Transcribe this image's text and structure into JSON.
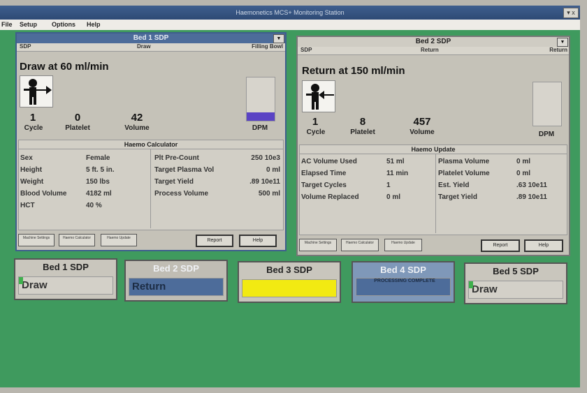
{
  "window": {
    "title": "Haemonetics MCS+ Monitoring Station",
    "control": "▾ x"
  },
  "menu": [
    "File",
    "Setup",
    "Options",
    "Help"
  ],
  "bed1": {
    "title": "Bed 1 SDP",
    "header": {
      "left": "SDP",
      "middle": "Draw",
      "right": "Filling Bowl"
    },
    "status": "Draw at 60 ml/min",
    "stats": [
      {
        "value": "1",
        "label": "Cycle"
      },
      {
        "value": "0",
        "label": "Platelet"
      },
      {
        "value": "42",
        "label": "Volume"
      }
    ],
    "dpm_label": "DPM",
    "dpm_level": 0.2,
    "calc_title": "Haemo Calculator",
    "left_rows": [
      [
        "Sex",
        "Female"
      ],
      [
        "Height",
        "5 ft. 5 in."
      ],
      [
        "Weight",
        "150 lbs"
      ],
      [
        "Blood Volume",
        "4182 ml"
      ],
      [
        "HCT",
        "40 %"
      ]
    ],
    "right_rows": [
      [
        "Plt Pre-Count",
        "250 10e3"
      ],
      [
        "Target Plasma Vol",
        "0 ml"
      ],
      [
        "Target Yield",
        ".89 10e11"
      ],
      [
        "Process Volume",
        "500 ml"
      ]
    ],
    "tabs": [
      "Machine Settings",
      "Haemo Calculator",
      "Haemo Update"
    ],
    "actions": [
      "Report",
      "Help"
    ]
  },
  "bed2": {
    "title": "Bed 2 SDP",
    "header": {
      "left": "SDP",
      "middle": "Return",
      "right": "Return"
    },
    "status": "Return at 150 ml/min",
    "stats": [
      {
        "value": "1",
        "label": "Cycle"
      },
      {
        "value": "8",
        "label": "Platelet"
      },
      {
        "value": "457",
        "label": "Volume"
      }
    ],
    "dpm_label": "DPM",
    "dpm_level": 0,
    "calc_title": "Haemo Update",
    "left_rows": [
      [
        "AC Volume Used",
        "51 ml"
      ],
      [
        "Elapsed Time",
        "11 min"
      ],
      [
        "Target Cycles",
        "1"
      ],
      [
        "Volume Replaced",
        "0 ml"
      ]
    ],
    "right_rows": [
      [
        "Plasma Volume",
        "0 ml"
      ],
      [
        "Platelet Volume",
        "0 ml"
      ],
      [
        "Est. Yield",
        ".63 10e11"
      ],
      [
        "Target Yield",
        ".89 10e11"
      ]
    ],
    "tabs": [
      "Machine Settings",
      "Haemo Calculator",
      "Haemo Update"
    ],
    "actions": [
      "Report",
      "Help"
    ]
  },
  "beds": [
    {
      "title": "Bed 1 SDP",
      "status": "Draw"
    },
    {
      "title": "Bed 2 SDP",
      "status": "Return"
    },
    {
      "title": "Bed 3 SDP",
      "status": ""
    },
    {
      "title": "Bed 4 SDP",
      "status": "PROCESSING COMPLETE"
    },
    {
      "title": "Bed 5 SDP",
      "status": "Draw"
    }
  ],
  "colors": {
    "desktop": "#3f9a5e",
    "titlebar": "#2e4a75",
    "panel_title": "#4d6c9a",
    "dpm_fill": "#5a43c4",
    "alert_yellow": "#f2ea12",
    "bed_selected": "#4d6c9a"
  }
}
